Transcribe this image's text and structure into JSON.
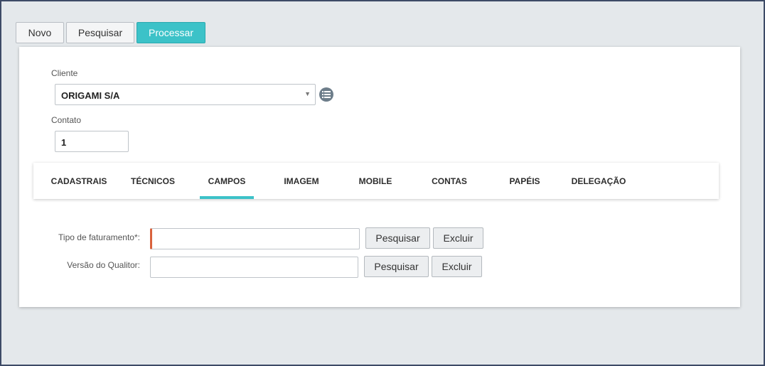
{
  "toolbar": {
    "novo": "Novo",
    "pesquisar": "Pesquisar",
    "processar": "Processar"
  },
  "form": {
    "cliente_label": "Cliente",
    "cliente_value": "ORIGAMI S/A",
    "contato_label": "Contato",
    "contato_value": "1"
  },
  "tabs": [
    {
      "label": "CADASTRAIS"
    },
    {
      "label": "TÉCNICOS"
    },
    {
      "label": "CAMPOS",
      "active": true
    },
    {
      "label": "IMAGEM"
    },
    {
      "label": "MOBILE"
    },
    {
      "label": "CONTAS"
    },
    {
      "label": "PAPÉIS"
    },
    {
      "label": "DELEGAÇÃO"
    }
  ],
  "campos": {
    "tipo_faturamento_label": "Tipo de faturamento*:",
    "versao_qualitor_label": "Versão do Qualitor:",
    "pesquisar": "Pesquisar",
    "excluir": "Excluir"
  },
  "colors": {
    "accent": "#3cc2c8",
    "required": "#d9623d"
  },
  "icons": {
    "select_arrow": "chevron-down-icon",
    "list": "list-icon"
  }
}
